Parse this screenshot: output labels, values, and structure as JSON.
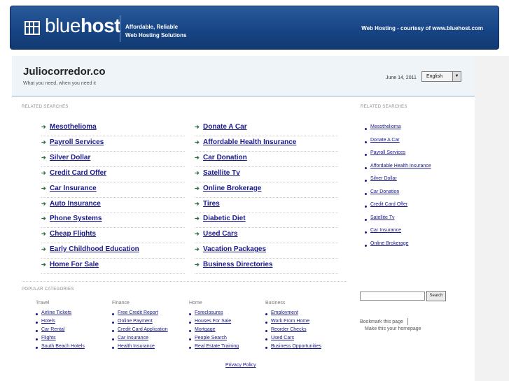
{
  "banner": {
    "logo_light": "blue",
    "logo_bold": "host",
    "tagline_line1": "Affordable, Reliable",
    "tagline_line2": "Web Hosting Solutions",
    "right_text": "Web Hosting - courtesy of www.bluehost.com"
  },
  "header": {
    "title": "Juliocorredor.co",
    "subtitle": "What you need, when you need it",
    "date": "June 14, 2011",
    "language": "English"
  },
  "related": {
    "label": "RELATED SEARCHES",
    "left": [
      "Mesothelioma",
      "Payroll Services",
      "Silver Dollar",
      "Credit Card Offer",
      "Car Insurance",
      "Auto Insurance",
      "Phone Systems",
      "Cheap Flights",
      "Early Childhood Education",
      "Home For Sale"
    ],
    "right": [
      "Donate A Car",
      "Affordable Health Insurance",
      "Car Donation",
      "Satellite Tv",
      "Online Brokerage",
      "Tires",
      "Diabetic Diet",
      "Used Cars",
      "Vacation Packages",
      "Business Directories"
    ]
  },
  "sidebar": {
    "label": "RELATED SEARCHES",
    "items": [
      "Mesothelioma",
      "Donate A Car",
      "Payroll Services",
      "Affordable Health Insurance",
      "Silver Dollar",
      "Car Donation",
      "Credit Card Offer",
      "Satellite Tv",
      "Car Insurance",
      "Online Brokerage"
    ],
    "search_button": "Search",
    "search_value": "",
    "bookmark": "Bookmark this page",
    "homepage": "Make this your homepage"
  },
  "popular": {
    "label": "POPULAR CATEGORIES",
    "columns": [
      {
        "title": "Travel",
        "links": [
          "Airline Tickets",
          "Hotels",
          "Car Rental",
          "Flights",
          "South Beach Hotels"
        ]
      },
      {
        "title": "Finance",
        "links": [
          "Free Credit Report",
          "Online Payment",
          "Credit Card Application",
          "Car Insurance",
          "Health Insurance"
        ]
      },
      {
        "title": "Home",
        "links": [
          "Foreclosures",
          "Houses For Sale",
          "Mortgage",
          "People Search",
          "Real Estate Training"
        ]
      },
      {
        "title": "Business",
        "links": [
          "Employment",
          "Work From Home",
          "Reorder Checks",
          "Used Cars",
          "Business Opportunities"
        ]
      }
    ]
  },
  "footer": {
    "privacy": "Privacy Policy"
  },
  "icons": {
    "logo": "grid-logo-icon",
    "arrow": "arrow-right-icon",
    "bullet": "bullet-icon",
    "dropdown": "chevron-down-icon"
  },
  "colors": {
    "banner": "#174585",
    "link": "#1a1a8a",
    "arrow": "#2c6e3f",
    "header_bg": "#eef4f8"
  }
}
